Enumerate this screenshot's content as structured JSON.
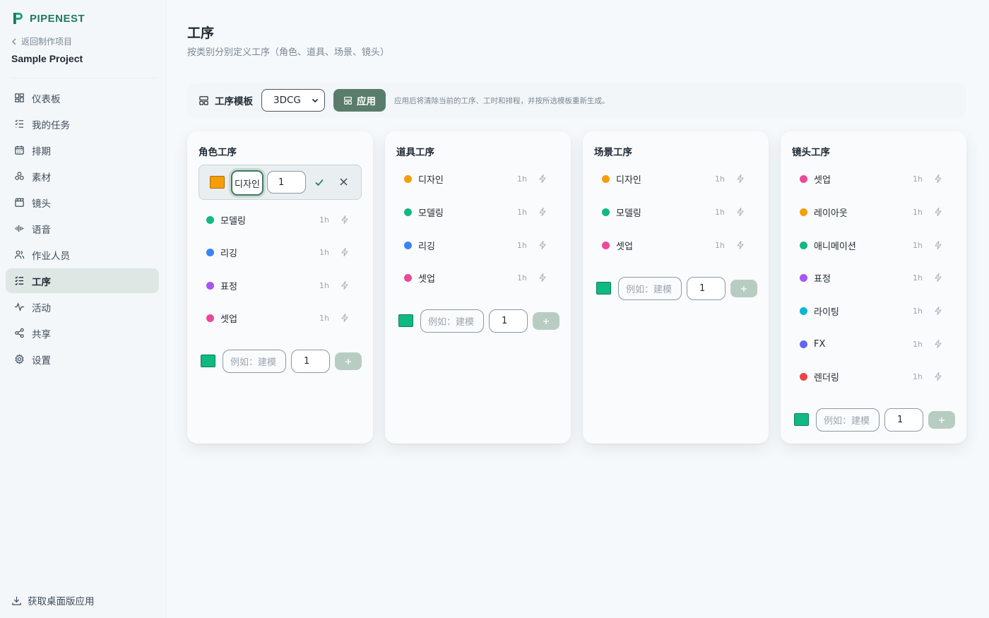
{
  "app": {
    "name": "PIPENEST",
    "brand_color": "#1f7a5a"
  },
  "sidebar": {
    "back_label": "返回制作项目",
    "project_name": "Sample Project",
    "items": [
      {
        "label": "仪表板",
        "icon": "dashboard-icon"
      },
      {
        "label": "我的任务",
        "icon": "task-list-icon"
      },
      {
        "label": "排期",
        "icon": "calendar-icon"
      },
      {
        "label": "素材",
        "icon": "assets-icon"
      },
      {
        "label": "镜头",
        "icon": "clapperboard-icon"
      },
      {
        "label": "语音",
        "icon": "audio-wave-icon"
      },
      {
        "label": "作业人员",
        "icon": "users-icon"
      },
      {
        "label": "工序",
        "icon": "checklist-icon",
        "active": true
      },
      {
        "label": "活动",
        "icon": "activity-icon"
      },
      {
        "label": "共享",
        "icon": "share-icon"
      },
      {
        "label": "设置",
        "icon": "gear-icon"
      }
    ],
    "desktop_app_label": "获取桌面版应用"
  },
  "page": {
    "title": "工序",
    "subtitle": "按类别分别定义工序（角色、道具、场景、镜头）"
  },
  "toolbar": {
    "template_label": "工序模板",
    "template_value": "3DCG",
    "apply_label": "应用",
    "hint": "应用后将清除当前的工序、工时和排程，并按所选模板重新生成。"
  },
  "columns": [
    {
      "title": "角色工序",
      "editing": {
        "name_value": "디자인",
        "hours_value": "1",
        "color": "#f59e0b"
      },
      "steps": [
        {
          "name": "모델링",
          "hours": "1h",
          "color": "#10b981"
        },
        {
          "name": "리깅",
          "hours": "1h",
          "color": "#3b82f6"
        },
        {
          "name": "표정",
          "hours": "1h",
          "color": "#a855f7"
        },
        {
          "name": "셋업",
          "hours": "1h",
          "color": "#ec4899"
        }
      ],
      "add": {
        "placeholder": "例如：建模",
        "hours_value": "1",
        "color": "#10b981"
      }
    },
    {
      "title": "道具工序",
      "steps": [
        {
          "name": "디자인",
          "hours": "1h",
          "color": "#f59e0b"
        },
        {
          "name": "모델링",
          "hours": "1h",
          "color": "#10b981"
        },
        {
          "name": "리깅",
          "hours": "1h",
          "color": "#3b82f6"
        },
        {
          "name": "셋업",
          "hours": "1h",
          "color": "#ec4899"
        }
      ],
      "add": {
        "placeholder": "例如：建模",
        "hours_value": "1",
        "color": "#10b981"
      }
    },
    {
      "title": "场景工序",
      "steps": [
        {
          "name": "디자인",
          "hours": "1h",
          "color": "#f59e0b"
        },
        {
          "name": "모델링",
          "hours": "1h",
          "color": "#10b981"
        },
        {
          "name": "셋업",
          "hours": "1h",
          "color": "#ec4899"
        }
      ],
      "add": {
        "placeholder": "例如：建模",
        "hours_value": "1",
        "color": "#10b981"
      }
    },
    {
      "title": "镜头工序",
      "steps": [
        {
          "name": "셋업",
          "hours": "1h",
          "color": "#ec4899"
        },
        {
          "name": "레이아웃",
          "hours": "1h",
          "color": "#f59e0b"
        },
        {
          "name": "애니메이션",
          "hours": "1h",
          "color": "#10b981"
        },
        {
          "name": "표정",
          "hours": "1h",
          "color": "#a855f7"
        },
        {
          "name": "라이팅",
          "hours": "1h",
          "color": "#06b6d4"
        },
        {
          "name": "FX",
          "hours": "1h",
          "color": "#6366f1"
        },
        {
          "name": "렌더링",
          "hours": "1h",
          "color": "#ef4444"
        }
      ],
      "add": {
        "placeholder": "例如：建模",
        "hours_value": "1",
        "color": "#10b981"
      }
    }
  ]
}
